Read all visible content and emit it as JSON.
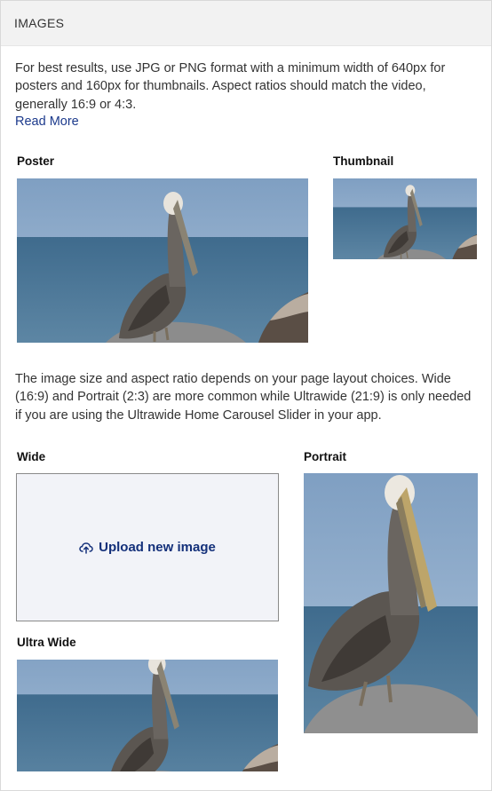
{
  "panel": {
    "title": "IMAGES"
  },
  "intro": {
    "text": "For best results, use JPG or PNG format with a minimum width of 640px for posters and 160px for thumbnails. Aspect ratios should match the video, generally 16:9 or 4:3.",
    "read_more": "Read More"
  },
  "labels": {
    "poster": "Poster",
    "thumbnail": "Thumbnail",
    "wide": "Wide",
    "portrait": "Portrait",
    "ultra_wide": "Ultra Wide"
  },
  "layout_note": {
    "text": "The image size and aspect ratio depends on your page layout choices. Wide (16:9) and Portrait (2:3) are more common while Ultrawide (21:9) is only needed if you are using the Ultrawide Home Carousel Slider in your app."
  },
  "upload": {
    "label": "Upload new image",
    "icon": "upload-cloud-icon"
  },
  "colors": {
    "link": "#1c3a8c",
    "upload_text": "#14307a",
    "header_bg": "#f2f2f2",
    "upload_bg": "#f2f3f8"
  }
}
